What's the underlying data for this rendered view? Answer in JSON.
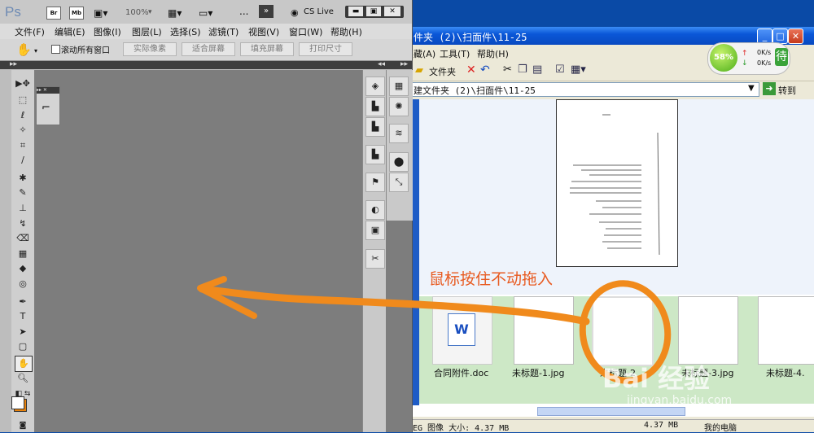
{
  "explorer": {
    "title": "件夹 (2)\\扫面件\\11-25",
    "menu": [
      "藏(A)",
      "工具(T)",
      "帮助(H)"
    ],
    "toolbar": {
      "folder_label": "文件夹"
    },
    "address": "建文件夹 (2)\\扫面件\\11-25",
    "go_label": "转到",
    "thumbnails": [
      {
        "label": "合同附件.doc"
      },
      {
        "label": "未标题-1.jpg"
      },
      {
        "label": "未标题-2"
      },
      {
        "label": "未标题-3.jpg"
      },
      {
        "label": "未标题-4."
      }
    ],
    "status_left": "EG 图像 大小: 4.37 MB",
    "status_right": "4.37 MB",
    "status_computer": "我的电脑"
  },
  "speed_widget": {
    "percent": "58%",
    "up": "0K/s",
    "down": "0K/s",
    "side_text": "待"
  },
  "photoshop": {
    "logo": "Ps",
    "br": "Br",
    "mb": "Mb",
    "zoom": "100%",
    "ellipsis": "...",
    "cs_live": "CS Live",
    "menu": [
      "文件(F)",
      "编辑(E)",
      "图像(I)",
      "图层(L)",
      "选择(S)",
      "滤镜(T)",
      "视图(V)",
      "窗口(W)",
      "帮助(H)"
    ],
    "options": {
      "scroll_all": "滚动所有窗口",
      "actual_pixels": "实际像素",
      "fit_screen": "适合屏幕",
      "fill_screen": "填充屏幕",
      "print_size": "打印尺寸"
    },
    "foreground_color": "#ffffff",
    "background_color": "#e8820c"
  },
  "annotation": {
    "text": "鼠标按住不动拖入",
    "color": "#f08a1c"
  },
  "watermark": {
    "main": "Bai 经验",
    "url": "jingyan.baidu.com"
  }
}
